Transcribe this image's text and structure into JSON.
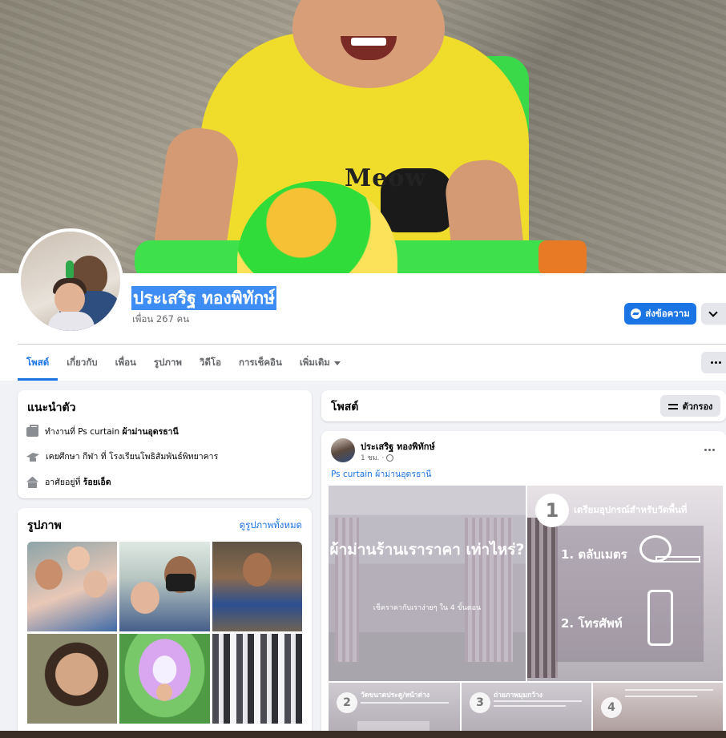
{
  "profile": {
    "name": "ประเสริฐ ทองพิทักษ์",
    "friends": "เพื่อน 267 คน",
    "message_button": "ส่งข้อความ"
  },
  "cover": {
    "shirt_text": "Meow"
  },
  "tabs": [
    {
      "label": "โพสต์",
      "active": true
    },
    {
      "label": "เกี่ยวกับ"
    },
    {
      "label": "เพื่อน"
    },
    {
      "label": "รูปภาพ"
    },
    {
      "label": "วิดีโอ"
    },
    {
      "label": "การเช็คอิน"
    },
    {
      "label": "เพิ่มเติม"
    }
  ],
  "intro": {
    "title": "แนะนำตัว",
    "work_prefix": "ทำงานที่ Ps curtain ",
    "work_place": "ผ้าม่านอุดรธานี",
    "study_prefix": "เคยศึกษา กีฬา ที่ ",
    "study_place": "โรงเรียนโพธิสัมพันธ์พิทยาคาร",
    "live_prefix": "อาศัยอยู่ที่ ",
    "live_place": "ร้อยเอ็ด"
  },
  "photos": {
    "title": "รูปภาพ",
    "see_all": "ดูรูปภาพทั้งหมด"
  },
  "posts": {
    "title": "โพสต์",
    "filter": "ตัวกรอง",
    "post": {
      "author": "ประเสริฐ ทองพิทักษ์",
      "time": "1 ชม. ·",
      "text": "Ps curtain ผ้าม่านอุดรธานี",
      "image1_title": "ผ้าม่านร้านเราราคา เท่าไหร่?",
      "image1_sub": "เช็คราคากับเราง่ายๆ ใน 4 ขั้นตอน",
      "image2_num": "1",
      "image2_title": "เตรียมอุปกรณ์สำหรับวัดพื้นที่",
      "image2_item1": "1. ตลับเมตร",
      "image2_item2": "2. โทรศัพท์",
      "thumb2_num": "2",
      "thumb2_title": "วัดขนาดประตู/หน้าต่าง",
      "thumb3_num": "3",
      "thumb3_title": "ถ่ายภาพมุมกว้าง",
      "thumb4_num": "4"
    }
  },
  "colors": {
    "accent": "#1b74e4",
    "background": "#f0f2f5"
  }
}
